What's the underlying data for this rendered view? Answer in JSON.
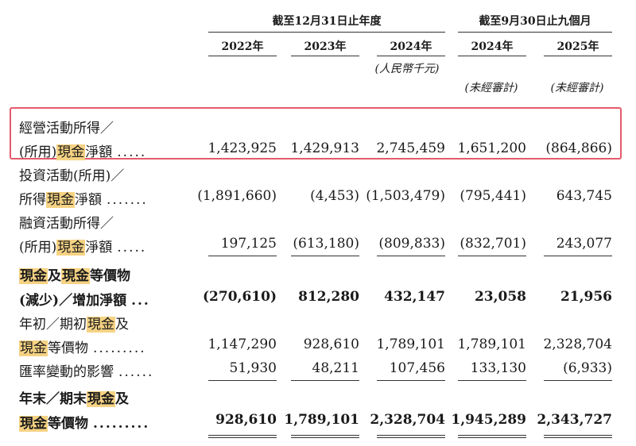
{
  "header": {
    "group_fy": "截至12月31日止年度",
    "group_9m": "截至9月30日止九個月",
    "years": [
      "2022年",
      "2023年",
      "2024年",
      "2024年",
      "2025年"
    ],
    "unit": "(人民幣千元)",
    "unaudited": [
      "(未經審計)",
      "(未經審計)"
    ]
  },
  "rows": [
    {
      "l1": [
        {
          "t": "經營活動所得／"
        }
      ],
      "l2": [
        {
          "t": "(所用)"
        },
        {
          "t": "現金",
          "hl": true
        },
        {
          "t": "淨額"
        }
      ],
      "dots": ".....",
      "values": [
        "1,423,925",
        "1,429,913",
        "2,745,459",
        "1,651,200",
        "(864,866)"
      ]
    },
    {
      "l1": [
        {
          "t": "投資活動(所用)／"
        }
      ],
      "l2": [
        {
          "t": "所得"
        },
        {
          "t": "現金",
          "hl": true
        },
        {
          "t": "淨額"
        }
      ],
      "dots": ".......",
      "values": [
        "(1,891,660)",
        "(4,453)",
        "(1,503,479)",
        "(795,441)",
        "643,745"
      ]
    },
    {
      "l1": [
        {
          "t": "融資活動所得／"
        }
      ],
      "l2": [
        {
          "t": "(所用)"
        },
        {
          "t": "現金",
          "hl": true
        },
        {
          "t": "淨額"
        }
      ],
      "dots": ".....",
      "values": [
        "197,125",
        "(613,180)",
        "(809,833)",
        "(832,701)",
        "243,077"
      ]
    },
    {
      "bold": true,
      "l1": [
        {
          "t": "現金",
          "hl": true
        },
        {
          "t": "及"
        },
        {
          "t": "現金",
          "hl": true
        },
        {
          "t": "等價物"
        }
      ],
      "l2": [
        {
          "t": "(減少)／增加淨額"
        }
      ],
      "dots": "...",
      "values": [
        "(270,610)",
        "812,280",
        "432,147",
        "23,058",
        "21,956"
      ]
    },
    {
      "l1": [
        {
          "t": "年初／期初"
        },
        {
          "t": "現金",
          "hl": true
        },
        {
          "t": "及"
        }
      ],
      "l2": [
        {
          "t": "現金",
          "hl": true
        },
        {
          "t": "等價物"
        }
      ],
      "dots": ".........",
      "values": [
        "1,147,290",
        "928,610",
        "1,789,101",
        "1,789,101",
        "2,328,704"
      ]
    },
    {
      "single": true,
      "l1": [
        {
          "t": "匯率變動的影響"
        }
      ],
      "dots": "......",
      "values": [
        "51,930",
        "48,211",
        "107,456",
        "133,130",
        "(6,933)"
      ]
    },
    {
      "bold": true,
      "l1": [
        {
          "t": "年末／期末"
        },
        {
          "t": "現金",
          "hl": true
        },
        {
          "t": "及"
        }
      ],
      "l2": [
        {
          "t": "現金",
          "hl": true
        },
        {
          "t": "等價物"
        }
      ],
      "dots": ".........",
      "values": [
        "928,610",
        "1,789,101",
        "2,328,704",
        "1,945,289",
        "2,343,727"
      ]
    }
  ]
}
